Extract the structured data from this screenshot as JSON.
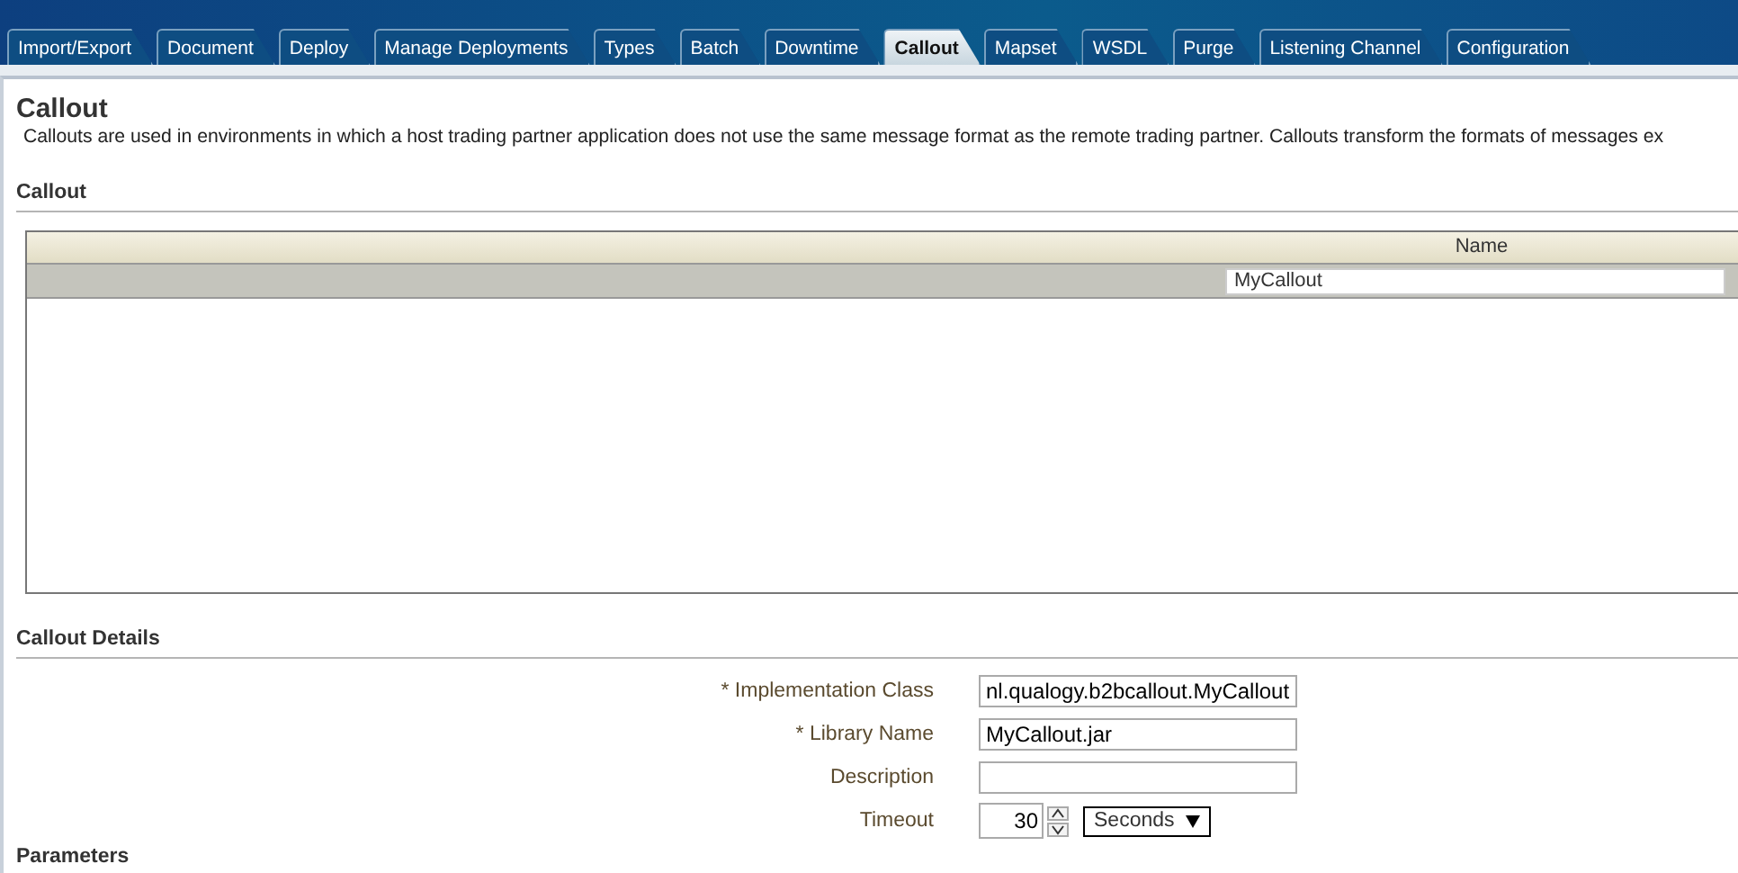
{
  "tabs": [
    {
      "label": "Import/Export",
      "selected": false
    },
    {
      "label": "Document",
      "selected": false
    },
    {
      "label": "Deploy",
      "selected": false
    },
    {
      "label": "Manage Deployments",
      "selected": false
    },
    {
      "label": "Types",
      "selected": false
    },
    {
      "label": "Batch",
      "selected": false
    },
    {
      "label": "Downtime",
      "selected": false
    },
    {
      "label": "Callout",
      "selected": true
    },
    {
      "label": "Mapset",
      "selected": false
    },
    {
      "label": "WSDL",
      "selected": false
    },
    {
      "label": "Purge",
      "selected": false
    },
    {
      "label": "Listening Channel",
      "selected": false
    },
    {
      "label": "Configuration",
      "selected": false
    }
  ],
  "page": {
    "title": "Callout",
    "description": "Callouts are used in environments in which a host trading partner application does not use the same message format as the remote trading partner. Callouts transform the formats of messages ex"
  },
  "callout_section": {
    "heading": "Callout",
    "table": {
      "columns": [
        "Name"
      ],
      "rows": [
        {
          "name": "MyCallout",
          "selected": true
        }
      ]
    }
  },
  "details_section": {
    "heading": "Callout Details",
    "fields": [
      {
        "kind": "text",
        "label": "* Implementation Class",
        "value": "nl.qualogy.b2bcallout.MyCallout"
      },
      {
        "kind": "text",
        "label": "* Library Name",
        "value": "MyCallout.jar"
      },
      {
        "kind": "text",
        "label": "Description"
      },
      {
        "kind": "timeout",
        "label": "Timeout",
        "value": "30",
        "unit": "Seconds"
      }
    ]
  },
  "parameters_section": {
    "heading": "Parameters"
  }
}
